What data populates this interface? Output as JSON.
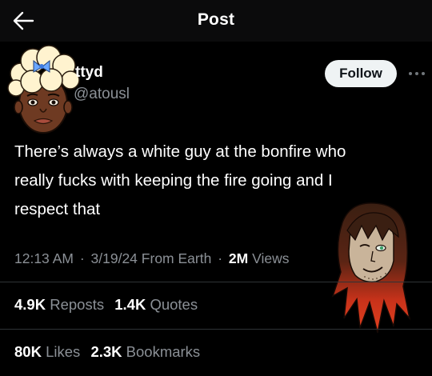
{
  "header": {
    "title": "Post",
    "back_icon": "arrow-left-icon"
  },
  "author": {
    "display_name": "ttyd",
    "handle": "@atousl",
    "follow_label": "Follow",
    "more_icon": "ellipsis-icon"
  },
  "post": {
    "text_lines": [
      "There’s always a white guy at the bonfire who",
      "really fucks with keeping the fire going and I",
      "respect that"
    ]
  },
  "meta": {
    "time": "12:13 AM",
    "separator": "·",
    "date": "3/19/24",
    "source": "From Earth",
    "views_count": "2M",
    "views_label": "Views"
  },
  "stats": {
    "row1": [
      {
        "count": "4.9K",
        "label": "Reposts"
      },
      {
        "count": "1.4K",
        "label": "Quotes"
      }
    ],
    "row2": [
      {
        "count": "80K",
        "label": "Likes"
      },
      {
        "count": "2.3K",
        "label": "Bookmarks"
      }
    ]
  },
  "colors": {
    "background": "#000000",
    "text_primary": "#ffffff",
    "text_secondary": "#8b9096",
    "divider": "#2f3336",
    "follow_bg": "#eff3f4"
  }
}
